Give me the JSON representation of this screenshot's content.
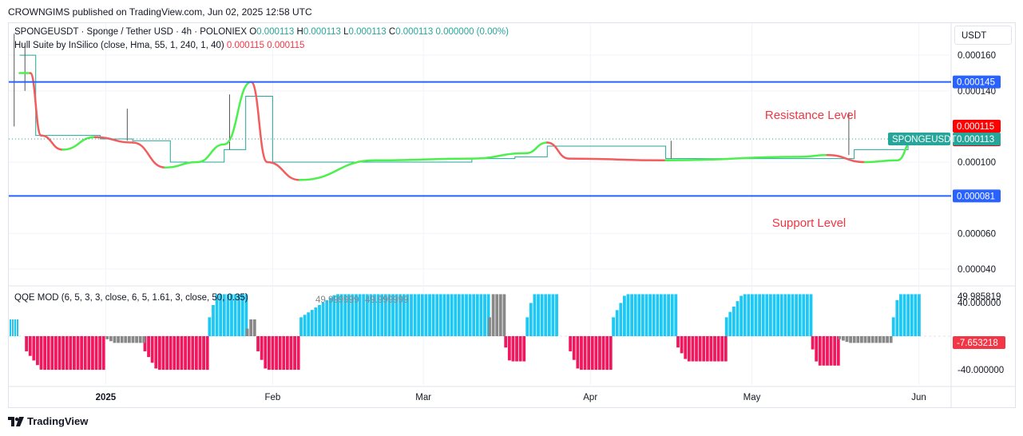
{
  "header": {
    "published": "CROWNGIMS published on TradingView.com, Jun 02, 2025 12:58 UTC"
  },
  "legend": {
    "symbol": "SPONGEUSDT · Sponge / Tether USD · 4h · POLONIEX",
    "o_label": "O",
    "o": "0.000113",
    "h_label": "H",
    "h": "0.000113",
    "l_label": "L",
    "l": "0.000113",
    "c_label": "C",
    "c": "0.000113",
    "change": "0.000000 (0.00%)",
    "indicator": "Hull Suite by InSilico (close, Hma, 55, 1, 240, 1, 40)",
    "ind_v1": "0.000115",
    "ind_v2": "0.000115",
    "qqe": "QQE MOD (6, 5, 3, 3, close, 6, 5, 1.61, 3, close, 50, 0.35)"
  },
  "currency": "USDT",
  "footer": {
    "brand": "TradingView"
  },
  "annotations": {
    "resistance": "Resistance Level",
    "support": "Support Level"
  },
  "colors": {
    "resistance_line": "#2962ff",
    "support_line": "#2962ff",
    "hull_up": "#4cf04c",
    "hull_down": "#f25c5c",
    "qqe_blue": "#1ec8f5",
    "qqe_pink": "#f0175e",
    "qqe_gray": "#888888",
    "price_tag": "#26a69a",
    "hull_tag": "#ff0000",
    "qqe_neg_tag": "#f23645"
  },
  "chart_data": [
    {
      "type": "line",
      "title": "SPONGEUSDT · Sponge / Tether USD · 4h · POLONIEX",
      "x_ticks": [
        "2025",
        "Feb",
        "Mar",
        "Apr",
        "May",
        "Jun"
      ],
      "y_ticks": [
        "0.000160",
        "0.000140",
        "0.000100",
        "0.000060",
        "0.000040"
      ],
      "ylim": [
        3.1e-05,
        0.000178
      ],
      "price_labels": {
        "resistance": "0.000145",
        "hull_1": "0.000115",
        "hull_2": "0.000115",
        "last_price_symbol": "SPONGEUSDT",
        "last_price": "0.000113",
        "support": "0.000081"
      },
      "levels": {
        "resistance": 0.000145,
        "support": 8.1e-05,
        "last": 0.000113
      },
      "price_series": {
        "name": "SPONGEUSDT",
        "x": [
          "2024-12-16",
          "2024-12-19",
          "2024-12-25",
          "2024-12-31",
          "2025-01-06",
          "2025-01-13",
          "2025-01-21",
          "2025-01-23",
          "2025-01-27",
          "2025-02-01",
          "2025-02-20",
          "2025-03-10",
          "2025-03-18",
          "2025-03-24",
          "2025-04-15",
          "2025-05-15",
          "2025-05-20",
          "2025-05-30"
        ],
        "close": [
          0.00016,
          0.000115,
          0.000115,
          0.000113,
          0.000112,
          0.0001,
          0.0001,
          0.000107,
          0.000137,
          0.0001,
          0.0001,
          0.000102,
          0.000103,
          0.000109,
          0.000102,
          0.000102,
          0.000107,
          0.000113
        ]
      },
      "hull_series": {
        "name": "Hull Suite",
        "x": [
          "2024-12-16",
          "2024-12-18",
          "2024-12-20",
          "2024-12-24",
          "2024-12-30",
          "2025-01-06",
          "2025-01-12",
          "2025-01-18",
          "2025-01-23",
          "2025-01-28",
          "2025-01-31",
          "2025-02-06",
          "2025-02-20",
          "2025-03-10",
          "2025-03-20",
          "2025-03-24",
          "2025-03-28",
          "2025-04-15",
          "2025-05-10",
          "2025-05-15",
          "2025-05-22",
          "2025-05-28",
          "2025-05-31"
        ],
        "y": [
          0.00015,
          0.00015,
          0.000115,
          0.000107,
          0.000114,
          0.000111,
          9.7e-05,
          0.0001,
          0.00011,
          0.000145,
          0.0001,
          9e-05,
          0.000101,
          0.000102,
          0.000105,
          0.000111,
          0.000102,
          0.000101,
          0.000103,
          0.000104,
          0.0001,
          0.000101,
          0.000113
        ]
      }
    },
    {
      "type": "bar",
      "title": "QQE MOD (6, 5, 3, 3, close, 6, 5, 1.61, 3, close, 50, 0.35)",
      "y_ticks": [
        "40.000000",
        "-40.000000"
      ],
      "ylim": [
        -58,
        58
      ],
      "overlay_values": [
        "49.999999",
        "49.999999"
      ],
      "labels": {
        "top": "49.985819",
        "current": "-7.653218"
      },
      "current": -7.653218,
      "series": [
        {
          "name": "blue",
          "segments": [
            {
              "start": "2025-01-20",
              "end": "2025-01-27",
              "value": 50
            },
            {
              "start": "2025-02-06",
              "end": "2025-03-13",
              "value": 50
            },
            {
              "start": "2025-03-20",
              "end": "2025-03-26",
              "value": 50
            },
            {
              "start": "2025-04-05",
              "end": "2025-04-17",
              "value": 50
            },
            {
              "start": "2025-04-26",
              "end": "2025-05-12",
              "value": 50
            },
            {
              "start": "2025-05-27",
              "end": "2025-06-01",
              "value": 50
            }
          ]
        },
        {
          "name": "pink",
          "segments": [
            {
              "start": "2024-12-17",
              "end": "2025-01-01",
              "value": -40
            },
            {
              "start": "2025-01-08",
              "end": "2025-01-20",
              "value": -40
            },
            {
              "start": "2025-01-29",
              "end": "2025-02-06",
              "value": -40
            },
            {
              "start": "2025-03-16",
              "end": "2025-03-20",
              "value": -30
            },
            {
              "start": "2025-03-28",
              "end": "2025-04-05",
              "value": -40
            },
            {
              "start": "2025-04-17",
              "end": "2025-04-26",
              "value": -30
            },
            {
              "start": "2025-05-12",
              "end": "2025-05-17",
              "value": -35
            }
          ]
        },
        {
          "name": "gray",
          "segments": [
            {
              "start": "2025-01-01",
              "end": "2025-01-08",
              "value": -8
            },
            {
              "start": "2025-01-27",
              "end": "2025-01-29",
              "value": 20
            },
            {
              "start": "2025-03-13",
              "end": "2025-03-16",
              "value": 50
            },
            {
              "start": "2025-05-17",
              "end": "2025-05-27",
              "value": -8
            }
          ]
        }
      ]
    }
  ]
}
